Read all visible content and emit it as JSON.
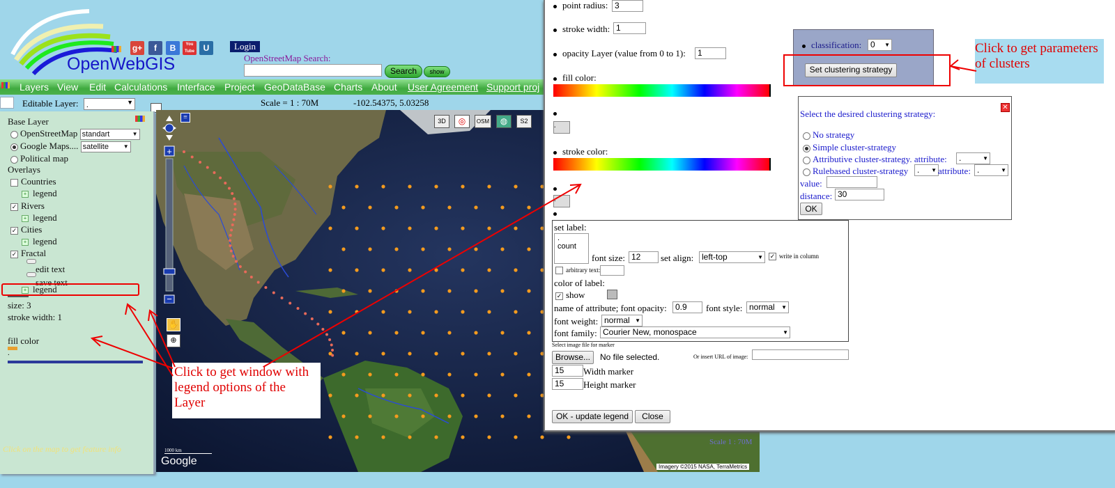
{
  "brand": {
    "name": "OpenWebGIS",
    "social": [
      "g+",
      "f",
      "B",
      "You Tube",
      "U"
    ]
  },
  "header": {
    "login": "Login",
    "osm_search_label": "OpenStreetMap  Search:",
    "search_button": "Search",
    "show_button": "show"
  },
  "menu": [
    "Layers",
    "View",
    "Edit",
    "Calculations",
    "Interface",
    "Project",
    "GeoDataBase",
    "Charts",
    "About",
    "User Agreement",
    "Support proj"
  ],
  "toolbar": {
    "editable_layer_label": "Editable Layer:",
    "editable_layer_value": ".",
    "scale": "Scale = 1 : 70M",
    "coords": "-102.54375, 5.03258"
  },
  "sidebar": {
    "base_layer_title": "Base Layer",
    "base_layers": [
      {
        "label": "OpenStreetMap",
        "select": "standart",
        "checked": false
      },
      {
        "label": "Google Maps....",
        "select": "satellite",
        "checked": true
      },
      {
        "label": "Political map",
        "checked": false
      }
    ],
    "overlays_title": "Overlays",
    "overlays": [
      {
        "label": "Countries",
        "checked": false,
        "legend": "legend"
      },
      {
        "label": "Rivers",
        "checked": true,
        "legend": "legend"
      },
      {
        "label": "Cities",
        "checked": true,
        "legend": "legend"
      },
      {
        "label": "Fractal",
        "checked": true,
        "edit": "edit text",
        "save": "save text",
        "legend": "legend"
      }
    ],
    "size": "size: 3",
    "stroke_width": "stroke width: 1",
    "fill_color": "fill color",
    "dot": ".",
    "footer": "Click on the map to get feature info"
  },
  "map": {
    "scalebar": "1000 km",
    "google": "Google",
    "attribution": "Imagery ©2015 NASA, TerraMetrics",
    "scale_overlay": "Scale 1 : 70M",
    "layer_icons": [
      "3D",
      "OSM",
      "S2"
    ]
  },
  "panel": {
    "point_radius_label": "point radius:",
    "point_radius": "3",
    "stroke_width_label": "stroke width:",
    "stroke_width": "1",
    "opacity_label": "opacity Layer (value from 0 to 1):",
    "opacity": "1",
    "fill_color_label": "fill color:",
    "stroke_color_label": "stroke color:",
    "dot": ".",
    "set_label": "set label:",
    "label_options": [
      ".",
      "count"
    ],
    "font_size_label": "font size:",
    "font_size": "12",
    "set_align_label": "set align:",
    "set_align": "left-top",
    "write_in_column": "write in column",
    "arbitrary_text": "arbitrary text:",
    "color_of_label": "color of label:",
    "show": "show",
    "name_of_attribute_label": "name of attribute; font opacity:",
    "font_opacity": "0.9",
    "font_style_label": "font style:",
    "font_style": "normal",
    "font_weight_label": "font weight:",
    "font_weight": "normal",
    "font_family_label": "font family:",
    "font_family": "Courier New, monospace",
    "select_image_label": "Select image file for marker",
    "browse_button": "Browse...",
    "no_file": "No file selected.",
    "insert_url_label": "Or insert URL of image:",
    "width_marker_value": "15",
    "width_marker_label": "Width marker",
    "height_marker_value": "15",
    "height_marker_label": "Height marker",
    "ok_update_button": "OK - update legend",
    "close_button": "Close"
  },
  "cluster": {
    "classification_label": "classification:",
    "classification_value": "0",
    "set_strategy_button": "Set clustering strategy",
    "strategy_title": "Select the desired clustering strategy:",
    "options": [
      {
        "label": "No strategy",
        "checked": false
      },
      {
        "label": "Simple cluster-strategy",
        "checked": true
      },
      {
        "label": "Attributive cluster-strategy. attribute:",
        "checked": false
      },
      {
        "label": "Rulebased cluster-strategy",
        "checked": false
      }
    ],
    "attribute_label": "attribute:",
    "attr_select": ".",
    "value_label": "value:",
    "distance_label": "distance:",
    "distance": "30",
    "ok_button": "OK"
  },
  "annotations": {
    "clusters_note": "Click to get parameters of clusters",
    "legend_note": "Click to get window with legend options of the Layer"
  },
  "colors": {
    "background": "#9fd6ea",
    "menubar": "#4cb04c",
    "annotation": "#e00000",
    "strategy_text": "#1a1acc"
  }
}
